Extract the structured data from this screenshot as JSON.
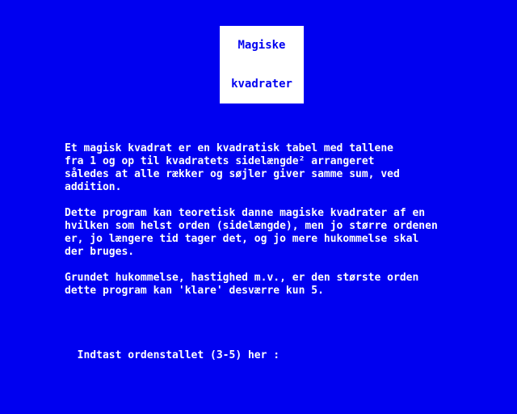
{
  "title": {
    "line1": "Magiske",
    "line2": "kvadrater"
  },
  "paragraphs": [
    [
      "Et magisk kvadrat er en kvadratisk tabel med tallene",
      "fra 1 og op til kvadratets sidelængde² arrangeret",
      "således at alle rækker og søjler giver samme sum, ved",
      "addition."
    ],
    [
      "Dette program kan teoretisk danne magiske kvadrater af en",
      "hvilken som helst orden (sidelængde), men jo større ordenen",
      "er, jo længere tid tager det, og jo mere hukommelse skal",
      "der bruges."
    ],
    [
      "Grundet hukommelse, hastighed m.v., er den største orden",
      "dette program kan 'klare' desværre kun 5."
    ]
  ],
  "prompt": {
    "label": "Indtast ordenstallet (3-5) her :",
    "value": ""
  },
  "colors": {
    "background": "#0000f0",
    "text": "#ffffff",
    "title_box": "#ffffff",
    "title_text": "#0000f0"
  }
}
